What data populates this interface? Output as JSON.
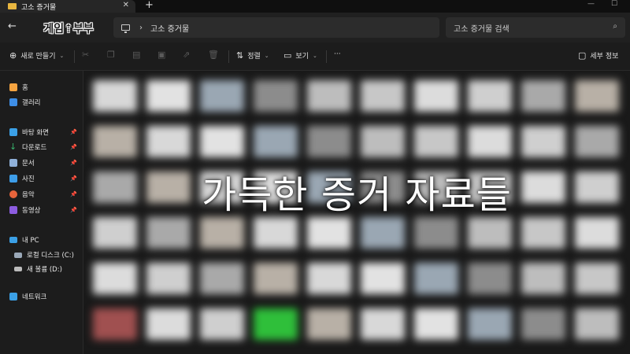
{
  "tab": {
    "title": "고소 증거물",
    "close": "✕",
    "new": "+"
  },
  "address": {
    "logo_text": "게임부부",
    "path": "고소 증거물",
    "search_placeholder": "고소 증거물 검색"
  },
  "toolbar": {
    "new_label": "새로 만들기",
    "sort_label": "정렬",
    "view_label": "보기",
    "more_label": "···",
    "details_label": "세부 정보"
  },
  "sidebar": {
    "items": [
      {
        "label": "홈",
        "icon": "home-icon",
        "color": "#f4a340"
      },
      {
        "label": "갤러리",
        "icon": "gallery-icon",
        "color": "#3e8ee6"
      },
      {
        "label": "바탕 화면",
        "icon": "desktop-icon",
        "color": "#3ba0e6"
      },
      {
        "label": "다운로드",
        "icon": "download-icon",
        "color": "#37b26c"
      },
      {
        "label": "문서",
        "icon": "document-icon",
        "color": "#8fb0d8"
      },
      {
        "label": "사진",
        "icon": "pictures-icon",
        "color": "#3d9de8"
      },
      {
        "label": "음악",
        "icon": "music-icon",
        "color": "#e8643b"
      },
      {
        "label": "동영상",
        "icon": "video-icon",
        "color": "#8c5ce0"
      },
      {
        "label": "내 PC",
        "icon": "this-pc-icon",
        "color": "#3ba0e6"
      },
      {
        "label": "로컬 디스크 (C:)",
        "icon": "drive-c-icon",
        "color": "#9aa8b8"
      },
      {
        "label": "새 볼륨 (D:)",
        "icon": "drive-d-icon",
        "color": "#bbbbbb"
      },
      {
        "label": "네트워크",
        "icon": "network-icon",
        "color": "#3ba0e6"
      }
    ]
  },
  "overlay_caption": "가득한 증거 자료들",
  "colors": {
    "accent": "#3ba0e6",
    "folder": "#e8b640"
  }
}
